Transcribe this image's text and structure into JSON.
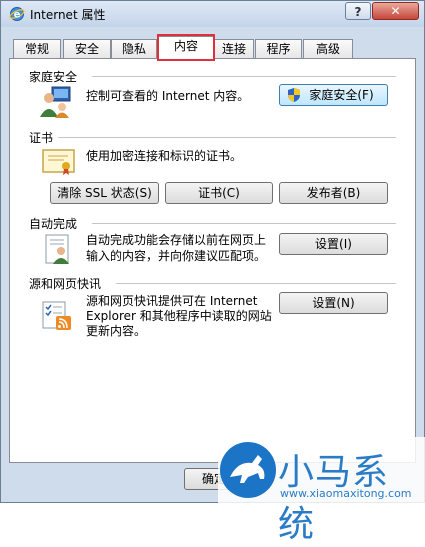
{
  "window": {
    "title": "Internet 属性",
    "help_label": "?",
    "close_label": "✕"
  },
  "tabs": [
    {
      "label": "常规"
    },
    {
      "label": "安全"
    },
    {
      "label": "隐私"
    },
    {
      "label": "内容"
    },
    {
      "label": "连接"
    },
    {
      "label": "程序"
    },
    {
      "label": "高级"
    }
  ],
  "sections": {
    "family": {
      "title": "家庭安全",
      "desc": "控制可查看的 Internet 内容。",
      "button": "家庭安全(F)"
    },
    "certs": {
      "title": "证书",
      "desc": "使用加密连接和标识的证书。",
      "btn_ssl": "清除 SSL 状态(S)",
      "btn_cert": "证书(C)",
      "btn_publisher": "发布者(B)"
    },
    "autocomplete": {
      "title": "自动完成",
      "desc_line1": "自动完成功能会存储以前在网页上",
      "desc_line2": "输入的内容，并向你建议匹配项。",
      "button": "设置(I)"
    },
    "feeds": {
      "title": "源和网页快讯",
      "desc_line1": "源和网页快讯提供可在 Internet",
      "desc_line2": "Explorer 和其他程序中读取的网站",
      "desc_line3": "更新内容。",
      "button": "设置(N)"
    }
  },
  "footer": {
    "ok": "确定"
  },
  "watermark": {
    "brand": "小马系统",
    "url": "www.xiaomaxitong.com"
  }
}
